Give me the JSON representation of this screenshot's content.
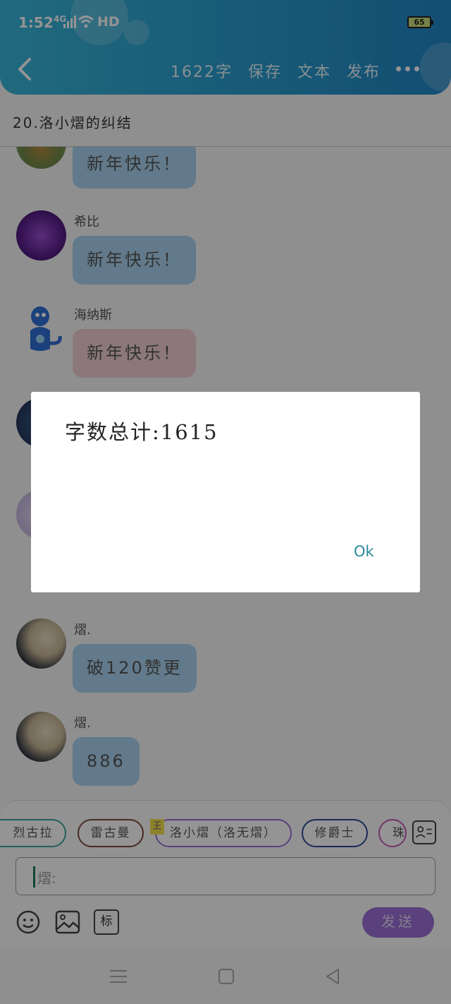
{
  "status_bar": {
    "time": "1:52",
    "signal": "4G",
    "network": "HD",
    "battery": "65"
  },
  "header": {
    "word_count": "1622字",
    "save": "保存",
    "text": "文本",
    "publish": "发布"
  },
  "chapter": {
    "title": "20.洛小熠的纠结"
  },
  "messages": [
    {
      "sender": "",
      "text": "新年快乐！",
      "color": "#a9d3ef"
    },
    {
      "sender": "希比",
      "text": "新年快乐！",
      "color": "#a9d3ef"
    },
    {
      "sender": "海纳斯",
      "text": "新年快乐！",
      "color": "#f1cfd2"
    },
    {
      "sender": "熠.",
      "text": "破120赞更",
      "color": "#a9d3ef"
    },
    {
      "sender": "熠.",
      "text": "886",
      "color": "#a9d3ef"
    }
  ],
  "characters": {
    "chip1": "烈古拉",
    "chip2": "雷古曼",
    "chip3": "洛小熠（洛无熠）",
    "chip4": "修爵士",
    "chip5": "珠",
    "king_badge": "王"
  },
  "input": {
    "prefix": "熠:"
  },
  "tools": {
    "mark_label": "标"
  },
  "send_label": "发送",
  "dialog": {
    "message": "字数总计:1615",
    "ok_label": "Ok"
  }
}
